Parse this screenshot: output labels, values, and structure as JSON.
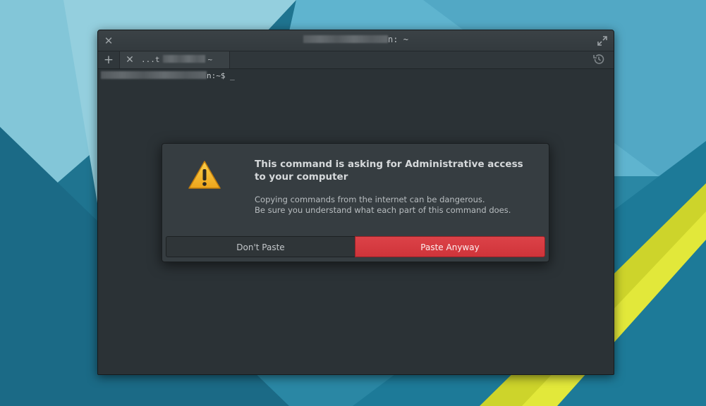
{
  "window": {
    "title": "n: ~",
    "tab_label": "...t",
    "tab_suffix": "~",
    "close_icon": "close-icon",
    "maximize_icon": "maximize-icon",
    "new_tab_icon": "plus-icon",
    "history_icon": "history-icon"
  },
  "terminal": {
    "prompt": "n:~$ ",
    "cursor": "_"
  },
  "dialog": {
    "icon": "warning-icon",
    "title": "This command is asking for Administrative access to your computer",
    "body_line1": "Copying commands from the internet can be dangerous.",
    "body_line2": "Be sure you understand what each part of this command does.",
    "cancel_label": "Don't Paste",
    "confirm_label": "Paste Anyway"
  },
  "colors": {
    "accent_destructive": "#d63b41",
    "warning": "#f6b427",
    "terminal_bg": "#2b3236"
  }
}
